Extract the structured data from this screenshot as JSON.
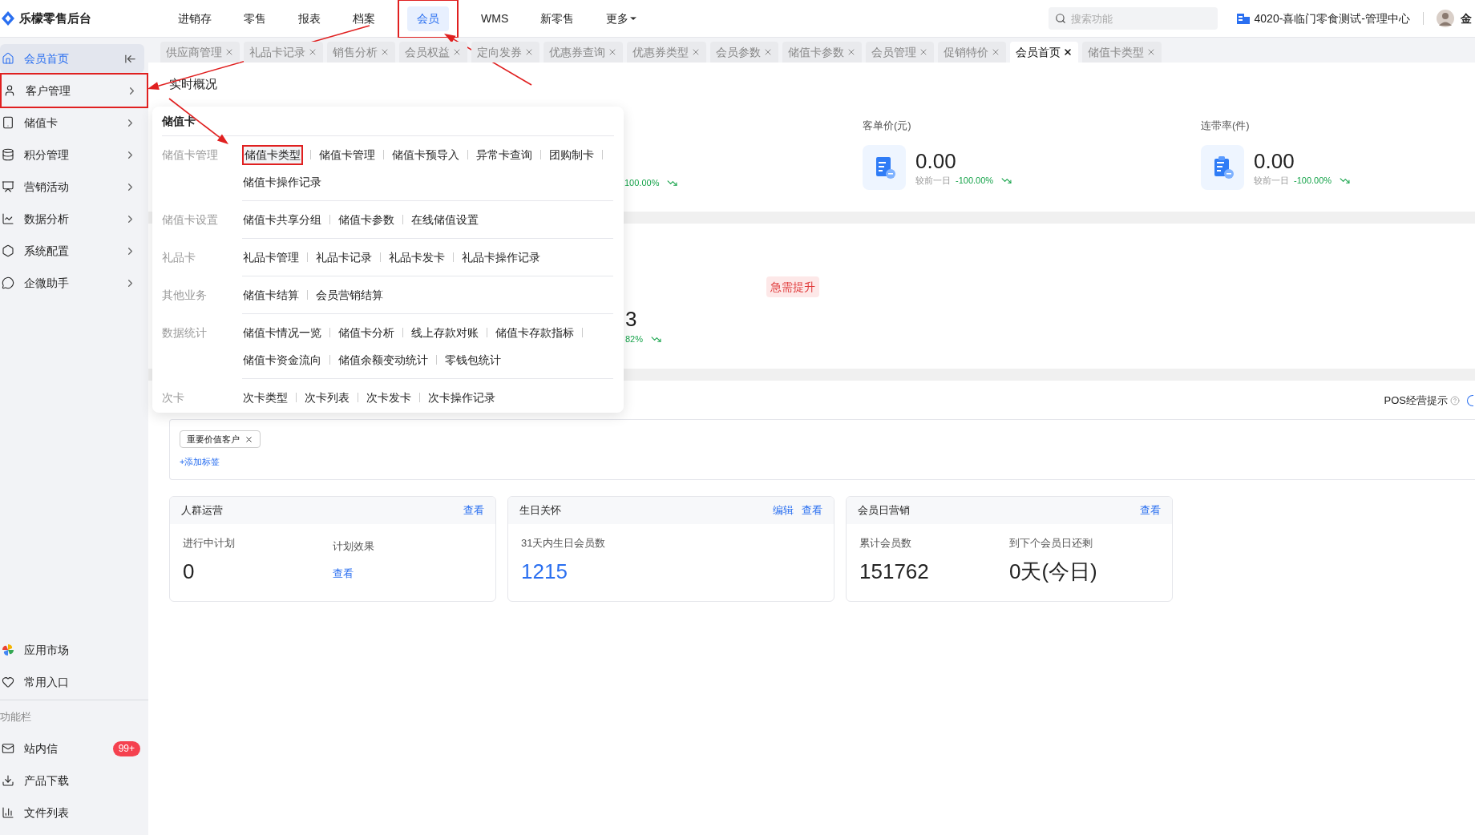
{
  "app": {
    "title": "乐檬零售后台"
  },
  "nav": [
    {
      "label": "进销存",
      "selected": false,
      "highlighted": false
    },
    {
      "label": "零售",
      "selected": false,
      "highlighted": false
    },
    {
      "label": "报表",
      "selected": false,
      "highlighted": false
    },
    {
      "label": "档案",
      "selected": false,
      "highlighted": false
    },
    {
      "label": "会员",
      "selected": true,
      "highlighted": true
    },
    {
      "label": "WMS",
      "selected": false,
      "highlighted": false
    },
    {
      "label": "新零售",
      "selected": false,
      "highlighted": false
    },
    {
      "label": "更多",
      "selected": false,
      "highlighted": false,
      "kind": "dropdown"
    }
  ],
  "search": {
    "placeholder": "搜索功能"
  },
  "store": "4020-喜临门零食测试-管理中心",
  "user": "金",
  "sidebar": {
    "items": [
      {
        "label": "会员首页",
        "kind": "collapse",
        "selected": true,
        "highlighted": false
      },
      {
        "label": "客户管理",
        "kind": "submenu",
        "selected": false,
        "highlighted": true
      },
      {
        "label": "储值卡",
        "kind": "submenu",
        "selected": false,
        "highlighted": false
      },
      {
        "label": "积分管理",
        "kind": "submenu",
        "selected": false,
        "highlighted": false
      },
      {
        "label": "营销活动",
        "kind": "submenu",
        "selected": false,
        "highlighted": false
      },
      {
        "label": "数据分析",
        "kind": "submenu",
        "selected": false,
        "highlighted": false
      },
      {
        "label": "系统配置",
        "kind": "submenu",
        "selected": false,
        "highlighted": false
      },
      {
        "label": "企微助手",
        "kind": "submenu",
        "selected": false,
        "highlighted": false
      }
    ],
    "bottom": [
      {
        "label": "应用市场"
      },
      {
        "label": "常用入口"
      }
    ],
    "function_bar": {
      "title": "功能栏",
      "items": [
        {
          "label": "站内信",
          "badge": "99+"
        },
        {
          "label": "产品下载"
        },
        {
          "label": "文件列表"
        }
      ]
    }
  },
  "tabs": [
    {
      "label": "供应商管理",
      "selected": false
    },
    {
      "label": "礼品卡记录",
      "selected": false
    },
    {
      "label": "销售分析",
      "selected": false
    },
    {
      "label": "会员权益",
      "selected": false
    },
    {
      "label": "定向发券",
      "selected": false
    },
    {
      "label": "优惠券查询",
      "selected": false
    },
    {
      "label": "优惠券类型",
      "selected": false
    },
    {
      "label": "会员参数",
      "selected": false
    },
    {
      "label": "储值卡参数",
      "selected": false
    },
    {
      "label": "会员管理",
      "selected": false
    },
    {
      "label": "促销特价",
      "selected": false
    },
    {
      "label": "会员首页",
      "selected": true
    },
    {
      "label": "储值卡类型",
      "selected": false
    }
  ],
  "overview": {
    "title": "实时概况",
    "stats": [
      {
        "kind": "hidden"
      },
      {
        "kind": "fragment",
        "change": "100.00%"
      },
      {
        "kind": "full",
        "label": "客单价(元)",
        "value": "0.00",
        "compare": "较前一日",
        "change": "-100.00%"
      },
      {
        "kind": "full",
        "label": "连带率(件)",
        "value": "0.00",
        "compare": "较前一日",
        "change": "-100.00%"
      }
    ]
  },
  "health": {
    "badge": "急需提升",
    "value": "3",
    "change": "82%"
  },
  "crm": {
    "tip": "POS经营提示",
    "tags": [
      {
        "label": "重要价值客户"
      }
    ],
    "add_tag": "+添加标签",
    "cards": [
      {
        "title": "人群运营",
        "actions": [
          "查看"
        ],
        "fields": [
          {
            "label": "进行中计划",
            "value": "0",
            "kind": "number"
          },
          {
            "label": "计划效果",
            "value": "查看",
            "kind": "link"
          }
        ]
      },
      {
        "title": "生日关怀",
        "actions": [
          "编辑",
          "查看"
        ],
        "fields": [
          {
            "label": "31天内生日会员数",
            "value": "1215",
            "kind": "highlight"
          }
        ]
      },
      {
        "title": "会员日营销",
        "actions": [
          "查看"
        ],
        "fields": [
          {
            "label": "累计会员数",
            "value": "151762",
            "kind": "number"
          },
          {
            "label": "到下个会员日还剩",
            "value": "0天(今日)",
            "kind": "number"
          }
        ]
      }
    ]
  },
  "menu": {
    "title": "储值卡",
    "groups": [
      {
        "label": "储值卡管理",
        "items": [
          {
            "label": "储值卡类型",
            "selected": true,
            "highlighted": true
          },
          {
            "label": "储值卡管理",
            "selected": false,
            "highlighted": false
          },
          {
            "label": "储值卡预导入",
            "selected": false,
            "highlighted": false
          },
          {
            "label": "异常卡查询",
            "selected": false,
            "highlighted": false
          },
          {
            "label": "团购制卡",
            "selected": false,
            "highlighted": false
          },
          {
            "label": "储值卡操作记录",
            "selected": false,
            "highlighted": false
          }
        ]
      },
      {
        "label": "储值卡设置",
        "items": [
          {
            "label": "储值卡共享分组",
            "selected": false,
            "highlighted": false
          },
          {
            "label": "储值卡参数",
            "selected": false,
            "highlighted": false
          },
          {
            "label": "在线储值设置",
            "selected": false,
            "highlighted": false
          }
        ]
      },
      {
        "label": "礼品卡",
        "items": [
          {
            "label": "礼品卡管理",
            "selected": false,
            "highlighted": false
          },
          {
            "label": "礼品卡记录",
            "selected": false,
            "highlighted": false
          },
          {
            "label": "礼品卡发卡",
            "selected": false,
            "highlighted": false
          },
          {
            "label": "礼品卡操作记录",
            "selected": false,
            "highlighted": false
          }
        ]
      },
      {
        "label": "其他业务",
        "items": [
          {
            "label": "储值卡结算",
            "selected": false,
            "highlighted": false
          },
          {
            "label": "会员营销结算",
            "selected": false,
            "highlighted": false
          }
        ]
      },
      {
        "label": "数据统计",
        "items": [
          {
            "label": "储值卡情况一览",
            "selected": false,
            "highlighted": false
          },
          {
            "label": "储值卡分析",
            "selected": false,
            "highlighted": false
          },
          {
            "label": "线上存款对账",
            "selected": false,
            "highlighted": false
          },
          {
            "label": "储值卡存款指标",
            "selected": false,
            "highlighted": false
          },
          {
            "label": "储值卡资金流向",
            "selected": false,
            "highlighted": false
          },
          {
            "label": "储值余额变动统计",
            "selected": false,
            "highlighted": false
          },
          {
            "label": "零钱包统计",
            "selected": false,
            "highlighted": false
          }
        ]
      },
      {
        "label": "次卡",
        "items": [
          {
            "label": "次卡类型",
            "selected": false,
            "highlighted": false
          },
          {
            "label": "次卡列表",
            "selected": false,
            "highlighted": false
          },
          {
            "label": "次卡发卡",
            "selected": false,
            "highlighted": false
          },
          {
            "label": "次卡操作记录",
            "selected": false,
            "highlighted": false
          }
        ]
      }
    ]
  }
}
